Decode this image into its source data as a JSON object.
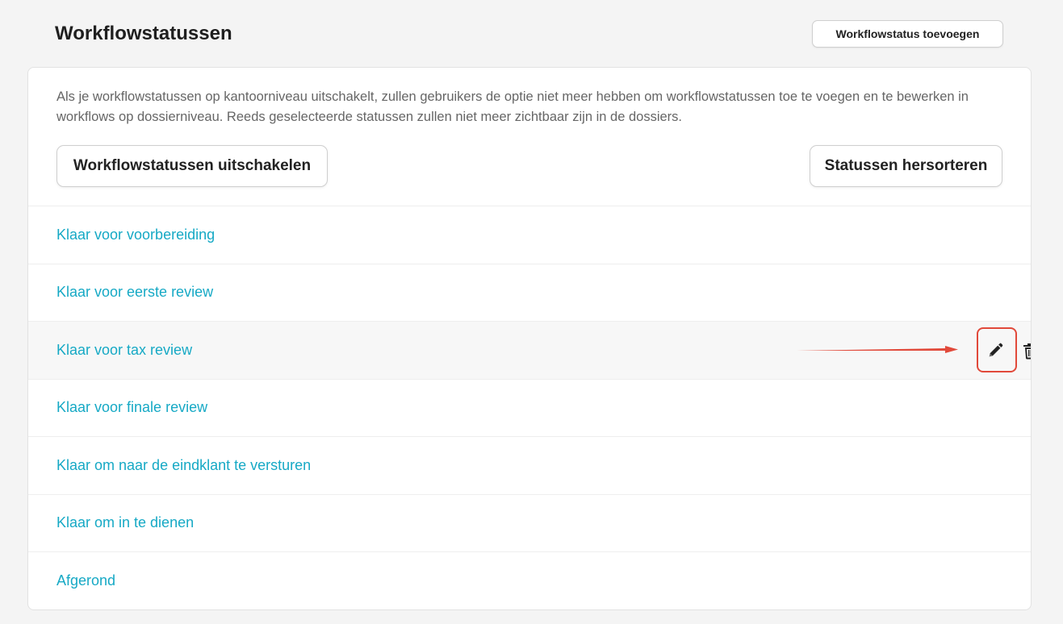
{
  "header": {
    "title": "Workflowstatussen",
    "add_button": "Workflowstatus toevoegen"
  },
  "card": {
    "info": "Als je workflowstatussen op kantoorniveau uitschakelt, zullen gebruikers de optie niet meer hebben om workflowstatussen toe te voegen en te bewerken in workflows op dossierniveau. Reeds geselecteerde statussen zullen niet meer zichtbaar zijn in de dossiers.",
    "disable_button": "Workflowstatussen uitschakelen",
    "reorder_button": "Statussen hersorteren"
  },
  "statuses": [
    "Klaar voor voorbereiding",
    "Klaar voor eerste review",
    "Klaar voor tax review",
    "Klaar voor finale review",
    "Klaar om naar de eindklant te versturen",
    "Klaar om in te dienen",
    "Afgerond"
  ],
  "icons": {
    "edit": "pencil-icon",
    "delete": "trash-icon",
    "annotation": "red-arrow"
  },
  "colors": {
    "link": "#16a9c5",
    "highlight": "#e1493a",
    "background": "#f4f4f4"
  }
}
